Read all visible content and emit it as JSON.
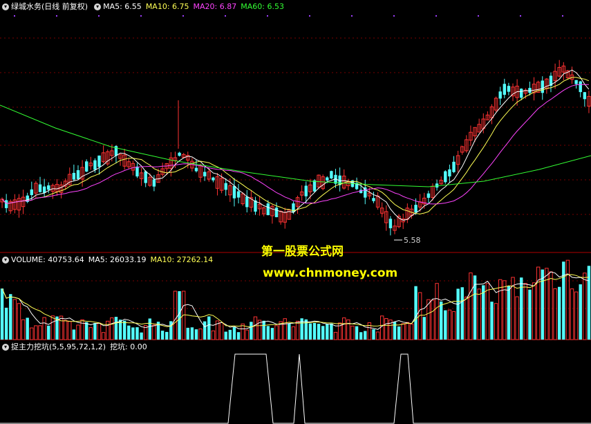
{
  "price_header": {
    "title": "绿城水务(日线 前复权)",
    "ma5": "MA5: 6.55",
    "ma10": "MA10: 6.75",
    "ma20": "MA20: 6.87",
    "ma60": "MA60: 6.53"
  },
  "volume_header": {
    "volume": "VOLUME: 40753.64",
    "ma5": "MA5: 26033.19",
    "ma10": "MA10: 27262.14"
  },
  "indicator_header": {
    "name": "捉主力挖坑(5,5,95,72,1,2)",
    "value": "挖坑: 0.00"
  },
  "low_marker": "5.58",
  "watermark": {
    "line1": "第一股票公式网",
    "line2": "www.chnmoney.com"
  },
  "colors": {
    "up": "#ff3333",
    "down": "#54ffff",
    "ma5": "#ffffff",
    "ma10": "#ffff55",
    "ma20": "#ff44ff",
    "ma60": "#33ff33",
    "grid": "#7a0000",
    "divider": "#b00000"
  }
}
